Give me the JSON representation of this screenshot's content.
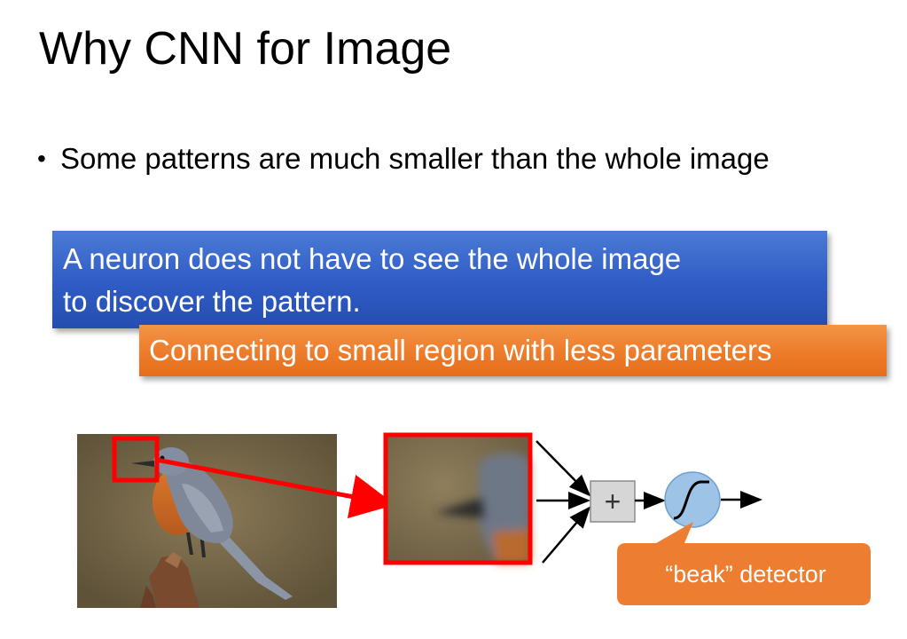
{
  "slide": {
    "title": "Why CNN for Image",
    "bullet": "Some patterns are much smaller than the whole image",
    "callout_blue": {
      "line1": "A neuron does not have to see the whole image",
      "line2": "to discover the pattern."
    },
    "callout_orange": "Connecting to small region with less parameters",
    "detector_label": "“beak” detector",
    "neuron_sum_symbol": "+"
  },
  "colors": {
    "blue_box": "#2f5bc4",
    "orange_box": "#ec7a28",
    "highlight_red": "#ff0000",
    "neuron_fill": "#9dc3e6"
  }
}
